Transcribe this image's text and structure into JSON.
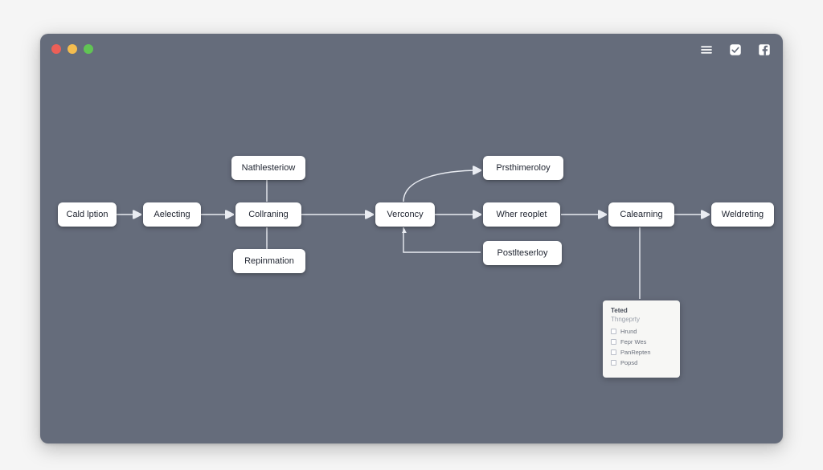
{
  "window": {
    "dot_labels": [
      "close",
      "minimize",
      "zoom"
    ]
  },
  "toolbar": {
    "icons": [
      "menu",
      "check",
      "facebook"
    ]
  },
  "flow": {
    "main": [
      {
        "id": "n1",
        "label": "Cald lption"
      },
      {
        "id": "n2",
        "label": "Aelecting"
      },
      {
        "id": "n3",
        "label": "Collraning"
      },
      {
        "id": "n4",
        "label": "Verconcy"
      },
      {
        "id": "n5",
        "label": "Wher reoplet"
      },
      {
        "id": "n6",
        "label": "Calearning"
      },
      {
        "id": "n7",
        "label": "Weldreting"
      }
    ],
    "above": [
      {
        "id": "na3",
        "parent": "n3",
        "label": "Nathlesteriow"
      },
      {
        "id": "na4",
        "parent": "n4",
        "label": "Prsthimeroloy"
      }
    ],
    "below": [
      {
        "id": "nb3",
        "parent": "n3",
        "label": "Repinmation"
      },
      {
        "id": "nb4",
        "parent": "n4",
        "label": "Postlteserloy"
      }
    ]
  },
  "panel": {
    "title1": "Teted",
    "title2": "Thngeprty",
    "options": [
      {
        "label": "Hrund"
      },
      {
        "label": "Fepr Wes"
      },
      {
        "label": "PanRepten"
      },
      {
        "label": "Popsd"
      }
    ]
  }
}
